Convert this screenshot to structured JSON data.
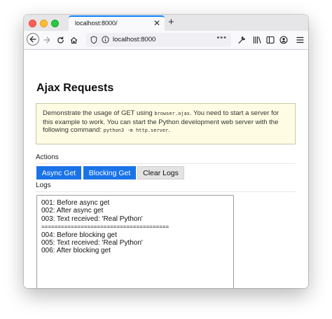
{
  "browser": {
    "tab_title": "localhost:8000/",
    "tab_close": "✕",
    "new_tab": "+",
    "url": "localhost:8000",
    "url_more": "•••"
  },
  "page": {
    "title": "Ajax Requests",
    "notice": {
      "text1": "Demonstrate the usage of GET using ",
      "code1": "browser.ajax",
      "text2": ". You need to start a server for this example to work. You can start the Python development web server with the following command: ",
      "code2": "python3 -m http.server",
      "text3": "."
    },
    "actions_label": "Actions",
    "buttons": {
      "async_get": "Async Get",
      "blocking_get": "Blocking Get",
      "clear_logs": "Clear Logs"
    },
    "logs_label": "Logs",
    "logs": [
      "001: Before async get",
      "002: After async get",
      "003: Text received: 'Real Python'",
      "=======================================",
      "004: Before blocking get",
      "005: Text received: 'Real Python'",
      "006: After blocking get"
    ]
  },
  "colors": {
    "accent": "#1a73e8",
    "notice_bg": "#fefde4",
    "tab_indicator": "#0a84ff"
  },
  "icons": [
    "back-arrow-icon",
    "forward-arrow-icon",
    "reload-icon",
    "home-icon",
    "shield-icon",
    "info-icon",
    "tools-icon",
    "library-icon",
    "sidebar-icon",
    "account-icon",
    "menu-icon"
  ]
}
